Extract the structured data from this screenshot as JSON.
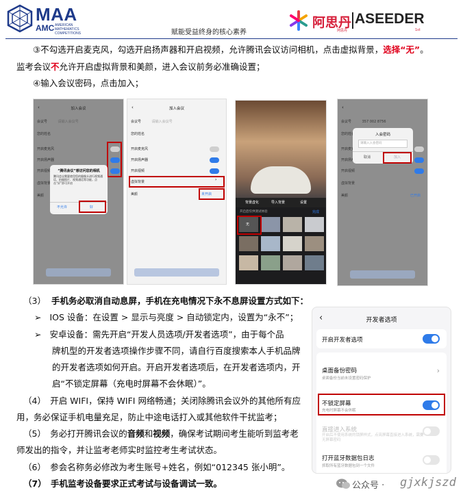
{
  "header": {
    "maa": "MAA",
    "amc": "AMC",
    "amc_sub": "AMERICAN MATHEMATICS COMPETITIONS",
    "motto": "赋能受益终身的核心素养",
    "brand_cn": "阿思丹",
    "brand_en": "ASEEDER",
    "brand_cn_small": "阿思丹",
    "brand_en_small": "1st"
  },
  "p3": {
    "a": "③不勾选开启麦克风，勾选开启扬声器和开启视频，允许腾讯会议访问相机，点击虚拟背景，",
    "b": "选择“无”",
    "c": "。",
    "d": "监考会议",
    "e": "不",
    "f": "允许开启虚拟背景和美颜，进入会议前务必准确设置；"
  },
  "p4": "④输入会议密码，点击加入；",
  "phone1": {
    "title": "加入会议",
    "row1": "会议号",
    "row1_ph": "请输入会议号",
    "row2": "您的姓名",
    "row3": "开启麦克风",
    "row4": "开启扬声器",
    "row5": "开启视频",
    "row6": "虚拟背景",
    "row7": "美颜",
    "dlg_title": "“腾讯会议”想访问您的相机",
    "dlg_body": "腾讯会议需要使用您的摄像头进行视频通话、拍摄照片、视频通话等功能，点击“好”即可开启",
    "deny": "不允许",
    "ok": "好"
  },
  "phone2": {
    "title": "加入会议",
    "row1": "会议号",
    "row1_ph": "请输入会议号",
    "row2": "您的姓名",
    "row3": "开启麦克风",
    "row4": "开启扬声器",
    "row5": "开启视频",
    "row6": "虚拟背景",
    "row7": "美颜",
    "row7_val": "未开启"
  },
  "phone3": {
    "tab1": "背景虚化",
    "tab2": "导入背景",
    "tab3": "设置",
    "hint": "开启后仅供测试体验",
    "none": "无",
    "done": "完成"
  },
  "phone4": {
    "row1": "会议号",
    "row1_val": "357 002 8756",
    "row2": "您的姓名",
    "row3": "开启麦克风",
    "row4": "开启扬声器",
    "row5": "开启视频",
    "row6": "虚拟背景",
    "row7": "美颜",
    "row7_val": "已开启",
    "dlg_title": "入会密码",
    "dlg_ph": "请输入入会密码",
    "cancel": "取消",
    "join": "加入"
  },
  "s3": {
    "num": "（3）",
    "text": "手机务必取消自动息屏，手机在充电情况下永不息屏设置方式如下："
  },
  "ios": {
    "bullet": "➢",
    "text": "IOS 设备：在设置 > 显示与亮度 > 自动锁定内，设置为“永不”；"
  },
  "android": {
    "bullet": "➢",
    "l1": "安卓设备：需先开启“开发人员选项/开发者选项”，由于每个品",
    "l2": "牌机型的开发者选项操作步骤不同，请自行百度搜索本人手机品牌",
    "l3": "的开发者选项如何开启。开启开发者选项后，在开发者选项内，开",
    "l4": "启“不锁定屏幕（充电时屏幕不会休眠）”。"
  },
  "s4": {
    "l1": "（4）　开启 WIFI，保持 WIFI 网络畅通；关闭除腾讯会议外的其他所有应",
    "l2": "用，务必保证手机电量充足，防止中途电话打入或其他软件干扰监考；"
  },
  "s5": {
    "a": "（5）　务必打开腾讯会议的",
    "b": "音频",
    "c": "和",
    "d": "视频",
    "e": "，确保考试期间考生能听到监考老",
    "l2": "师发出的指令，并让监考老师实时监控考生考试状态。"
  },
  "s6": "（6）　参会名称务必修改为考生账号+姓名，例如“012345 张小明”。",
  "s7": "（7）　手机监考设备要求正式考试与设备调试一致。",
  "settings": {
    "back": "‹",
    "title": "开发者选项",
    "r1": "开启开发者选项",
    "r2": "桌面备份密码",
    "r2_sub": "桌面备份当前未设置密码保护",
    "r3": "不锁定屏幕",
    "r3_sub": "充电时屏幕不会休眠",
    "r4": "直接进入系统",
    "r4_sub": "开启后不使用系统的锁屏样式，点亮屏幕直接进入系统，需要无屏幕密码",
    "r5": "打开蓝牙数据包日志",
    "r5_sub": "抓取所有蓝牙数据包到一个文件",
    "chev": "›"
  },
  "watermark": {
    "label": "公众号 · ",
    "id": "gjxkjszd"
  }
}
